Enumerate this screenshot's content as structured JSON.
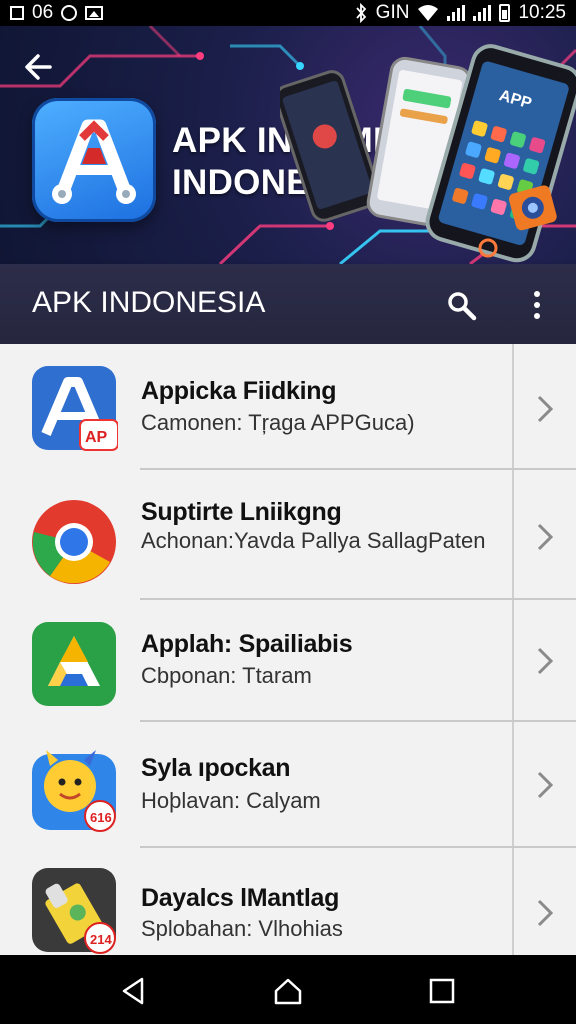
{
  "status_bar": {
    "left_text": "06",
    "network": "GIN",
    "time": "10:25",
    "icons": [
      "image-icon",
      "circle-icon",
      "gallery-icon",
      "bluetooth-icon",
      "wifi-icon",
      "signal-icon",
      "battery-icon"
    ]
  },
  "banner": {
    "title_line1": "APK INDAMIR",
    "title_line2": "INDONESIA",
    "phone_text": "APP",
    "colors": {
      "background": "#1b1f4a",
      "accent_pink": "#ff3d7f",
      "accent_cyan": "#36d6ff",
      "logo_blue": "#2a86f0"
    }
  },
  "toolbar": {
    "title": "APK INDONESIA",
    "search_icon": "search-icon",
    "more_icon": "more-vert-icon"
  },
  "list": {
    "items": [
      {
        "title": "Appicka Fiidking",
        "subtitle": "Camonen: Tŗaga APPGuca)",
        "icon": "app-store-icon",
        "badge": "AP"
      },
      {
        "title": "Suptirte Lniikgng",
        "subtitle": "Achonan:Yavda Pallya SallagPaten",
        "icon": "chrome-icon",
        "badge": ""
      },
      {
        "title": "Applah: Spailiabis",
        "subtitle": "Cbponan: Ttaram",
        "icon": "drive-icon",
        "badge": ""
      },
      {
        "title": "Syla ıpockan",
        "subtitle": "Hoþlavan: Calyam",
        "icon": "smiley-icon",
        "badge": "616"
      },
      {
        "title": "Dayalcs lMantlag",
        "subtitle": "Splobahan: Vlhohias",
        "icon": "tool-icon",
        "badge": "214"
      }
    ]
  },
  "nav_bar": {
    "icons": [
      "back-icon",
      "home-icon",
      "recents-icon"
    ]
  }
}
